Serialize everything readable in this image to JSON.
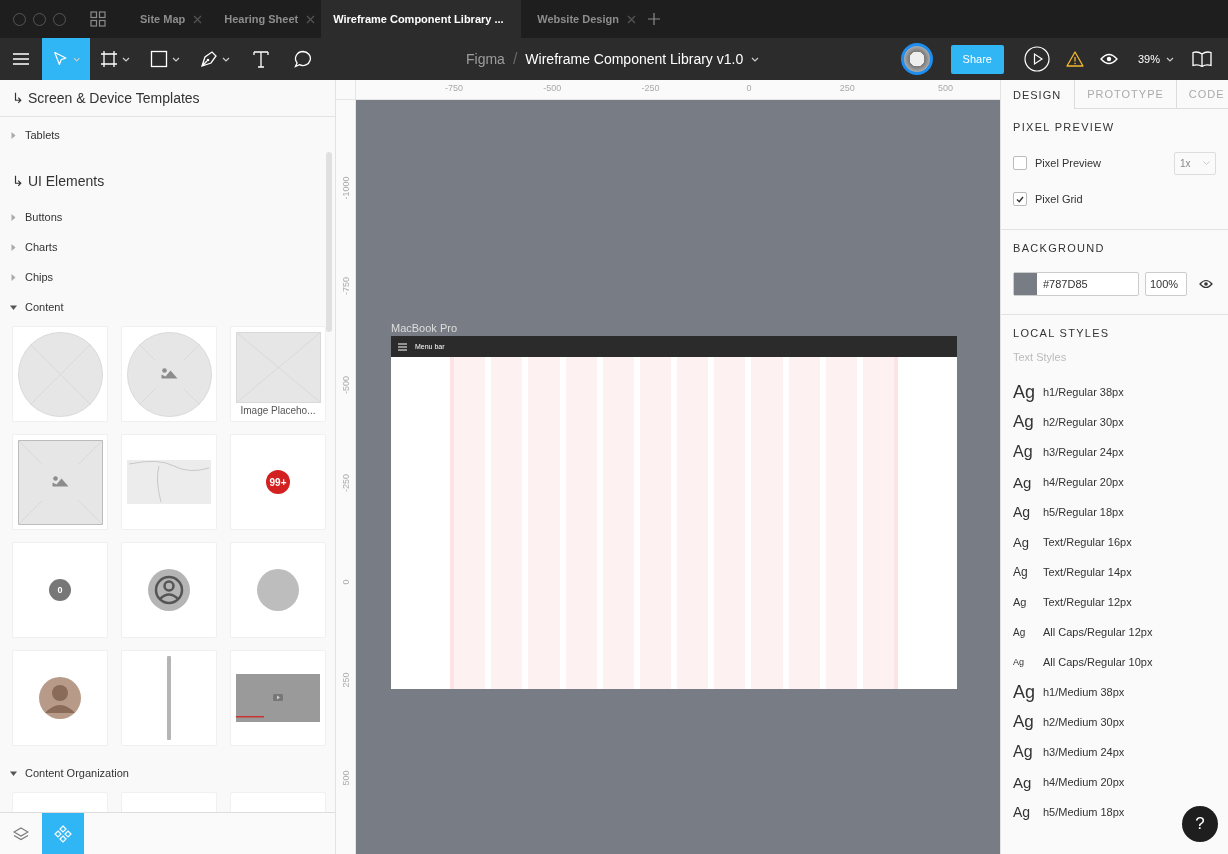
{
  "titlebar": {
    "tabs": [
      {
        "label": "Site Map",
        "selected": false
      },
      {
        "label": "Hearing Sheet",
        "selected": false
      },
      {
        "label": "Wireframe Component Library ...",
        "selected": true
      },
      {
        "label": "Website Design",
        "selected": false
      }
    ]
  },
  "toolbar": {
    "tools": [
      {
        "kind": "move",
        "selected": true,
        "dropdown": true
      },
      {
        "kind": "frame",
        "selected": false,
        "dropdown": true
      },
      {
        "kind": "rectangle",
        "selected": false,
        "dropdown": true
      },
      {
        "kind": "pen",
        "selected": false,
        "dropdown": true
      },
      {
        "kind": "text",
        "selected": false,
        "dropdown": false
      },
      {
        "kind": "comment",
        "selected": false,
        "dropdown": false
      }
    ],
    "project": "Figma",
    "separator": "/",
    "file": "Wireframe Component Library v1.0",
    "share": "Share",
    "zoom": "39%"
  },
  "left_panel": {
    "sections": [
      {
        "title": "↳ Screen & Device Templates",
        "groups": [
          {
            "label": "Tablets",
            "expanded": false
          }
        ]
      },
      {
        "title": "↳ UI Elements",
        "groups": [
          {
            "label": "Buttons",
            "expanded": false
          },
          {
            "label": "Charts",
            "expanded": false
          },
          {
            "label": "Chips",
            "expanded": false
          },
          {
            "label": "Content",
            "expanded": true,
            "tiles": [
              {
                "kind": "circle-cross"
              },
              {
                "kind": "circle-image"
              },
              {
                "kind": "rect-cross",
                "label": "Image Placeho..."
              },
              {
                "kind": "rect-image"
              },
              {
                "kind": "map"
              },
              {
                "kind": "badge",
                "text": "99+"
              },
              {
                "kind": "count",
                "text": "0"
              },
              {
                "kind": "user"
              },
              {
                "kind": "disc"
              },
              {
                "kind": "avatar"
              },
              {
                "kind": "divider"
              },
              {
                "kind": "video"
              }
            ]
          },
          {
            "label": "Content Organization",
            "expanded": true,
            "tiles": [
              {
                "kind": "blank"
              },
              {
                "kind": "blank"
              },
              {
                "kind": "blank"
              }
            ]
          }
        ]
      }
    ],
    "bottom_tabs": [
      {
        "kind": "layers",
        "selected": false
      },
      {
        "kind": "components",
        "selected": true
      }
    ]
  },
  "canvas": {
    "x_ticks": [
      "-750",
      "-500",
      "-250",
      "0",
      "250",
      "500"
    ],
    "y_ticks": [
      "-1000",
      "-750",
      "-500",
      "-250",
      "0",
      "250",
      "500"
    ],
    "frame": {
      "name": "MacBook Pro",
      "menu_label": "Menu bar"
    }
  },
  "right_panel": {
    "tabs": [
      {
        "label": "DESIGN",
        "selected": true
      },
      {
        "label": "PROTOTYPE",
        "selected": false
      },
      {
        "label": "CODE",
        "selected": false
      }
    ],
    "pixel_preview": {
      "title": "PIXEL PREVIEW",
      "options": [
        {
          "label": "Pixel Preview",
          "checked": false
        },
        {
          "label": "Pixel Grid",
          "checked": true
        }
      ],
      "scale": "1x"
    },
    "background": {
      "title": "BACKGROUND",
      "color": "#787D85",
      "opacity": "100%"
    },
    "local_styles": {
      "title": "LOCAL STYLES",
      "subtitle": "Text Styles",
      "styles": [
        {
          "kind": "h1",
          "preview": "Ag",
          "name": "h1/Regular 38px"
        },
        {
          "kind": "h2",
          "preview": "Ag",
          "name": "h2/Regular 30px"
        },
        {
          "kind": "h3",
          "preview": "Ag",
          "name": "h3/Regular 24px"
        },
        {
          "kind": "h4",
          "preview": "Ag",
          "name": "h4/Regular 20px"
        },
        {
          "kind": "h5",
          "preview": "Ag",
          "name": "h5/Regular 18px"
        },
        {
          "kind": "text16",
          "preview": "Ag",
          "name": "Text/Regular 16px"
        },
        {
          "kind": "text14",
          "preview": "Ag",
          "name": "Text/Regular 14px"
        },
        {
          "kind": "text12",
          "preview": "Ag",
          "name": "Text/Regular 12px"
        },
        {
          "kind": "caps12",
          "preview": "Ag",
          "name": "All Caps/Regular 12px"
        },
        {
          "kind": "caps10",
          "preview": "Ag",
          "name": "All Caps/Regular 10px"
        },
        {
          "kind": "h1",
          "preview": "Ag",
          "name": "h1/Medium 38px"
        },
        {
          "kind": "h2",
          "preview": "Ag",
          "name": "h2/Medium 30px"
        },
        {
          "kind": "h3",
          "preview": "Ag",
          "name": "h3/Medium 24px"
        },
        {
          "kind": "h4",
          "preview": "Ag",
          "name": "h4/Medium 20px"
        },
        {
          "kind": "h5",
          "preview": "Ag",
          "name": "h5/Medium 18px"
        }
      ]
    }
  },
  "help": "?"
}
